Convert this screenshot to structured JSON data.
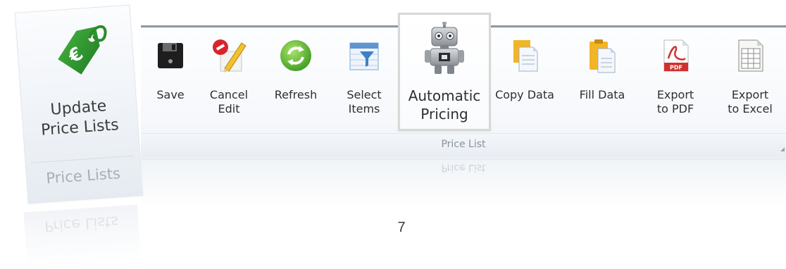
{
  "left_card": {
    "button_label": "Update\nPrice Lists",
    "group_label": "Price Lists",
    "icon": "euro-price-tag-icon",
    "accent_color": "#2e8b2e"
  },
  "ribbon": {
    "group_caption": "Price List",
    "buttons": [
      {
        "label": "Save",
        "icon": "floppy-disk-icon"
      },
      {
        "label": "Cancel\nEdit",
        "icon": "cancel-edit-icon"
      },
      {
        "label": "Refresh",
        "icon": "refresh-icon"
      },
      {
        "label": "Select\nItems",
        "icon": "filter-select-icon"
      },
      {
        "label": "Automatic\nPricing",
        "icon": "robot-icon"
      },
      {
        "label": "Copy Data",
        "icon": "copy-documents-icon"
      },
      {
        "label": "Fill Data",
        "icon": "fill-clipboard-icon"
      },
      {
        "label": "Export\nto PDF",
        "icon": "pdf-icon"
      },
      {
        "label": "Export\nto Excel",
        "icon": "excel-sheet-icon"
      }
    ]
  },
  "page_number": "7"
}
